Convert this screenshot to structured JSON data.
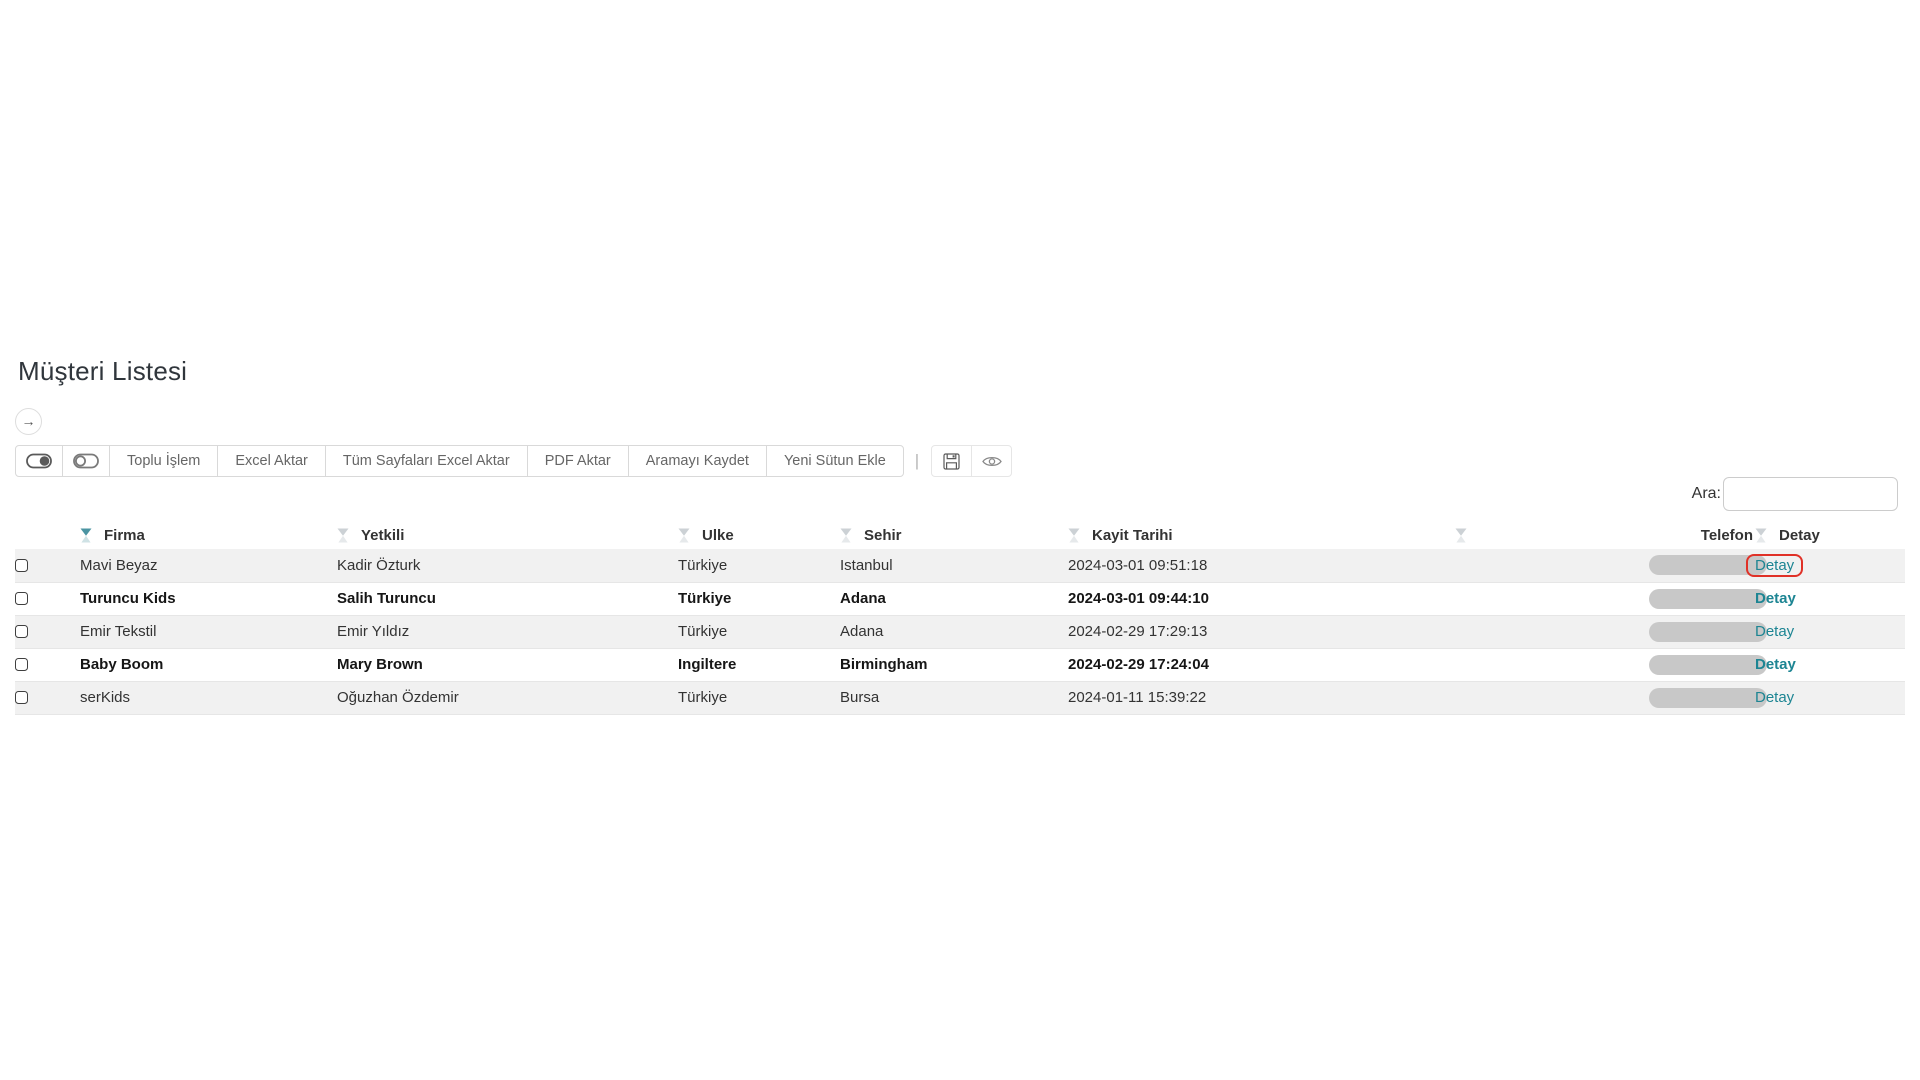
{
  "page": {
    "title": "Müşteri Listesi"
  },
  "panel_toggle": {
    "arrow_icon": "→"
  },
  "toolbar": {
    "buttons": [
      "Toplu İşlem",
      "Excel Aktar",
      "Tüm Sayfaları Excel Aktar",
      "PDF Aktar",
      "Aramayı Kaydet",
      "Yeni Sütun Ekle"
    ],
    "divider": "|",
    "icon_buttons": [
      "save-icon",
      "eye-icon"
    ],
    "toggle_icons": [
      "toggle-on-icon",
      "toggle-off-icon"
    ]
  },
  "search": {
    "label": "Ara:",
    "value": "",
    "placeholder": ""
  },
  "table": {
    "headers": {
      "firma": "Firma",
      "yetkili": "Yetkili",
      "ulke": "Ulke",
      "sehir": "Sehir",
      "kayit": "Kayit Tarihi",
      "telefon": "Telefon",
      "detay": "Detay"
    },
    "rows": [
      {
        "firma": "Mavi Beyaz",
        "yetkili": "Kadir Özturk",
        "ulke": "Türkiye",
        "sehir": "Istanbul",
        "kayit_tarihi": "2024-03-01 09:51:18",
        "telefon_redacted": true,
        "detay": "Detay",
        "bold": false,
        "highlighted": true
      },
      {
        "firma": "Turuncu Kids",
        "yetkili": "Salih Turuncu",
        "ulke": "Türkiye",
        "sehir": "Adana",
        "kayit_tarihi": "2024-03-01 09:44:10",
        "telefon_redacted": true,
        "detay": "Detay",
        "bold": true,
        "highlighted": false
      },
      {
        "firma": "Emir Tekstil",
        "yetkili": "Emir Yıldız",
        "ulke": "Türkiye",
        "sehir": "Adana",
        "kayit_tarihi": "2024-02-29 17:29:13",
        "telefon_redacted": true,
        "detay": "Detay",
        "bold": false,
        "highlighted": false
      },
      {
        "firma": "Baby Boom",
        "yetkili": "Mary Brown",
        "ulke": "Ingiltere",
        "sehir": "Birmingham",
        "kayit_tarihi": "2024-02-29 17:24:04",
        "telefon_redacted": true,
        "detay": "Detay",
        "bold": true,
        "highlighted": false
      },
      {
        "firma": "serKids",
        "yetkili": "Oğuzhan Özdemir",
        "ulke": "Türkiye",
        "sehir": "Bursa",
        "kayit_tarihi": "2024-01-11 15:39:22",
        "telefon_redacted": true,
        "detay": "Detay",
        "bold": false,
        "highlighted": false
      }
    ]
  },
  "colors": {
    "accent_teal": "#1d8593",
    "highlight_red": "#e03127",
    "stripe_gray": "#f1f1f1",
    "pill_gray": "#c8c8c8",
    "filter_active_teal": "#4b94a2",
    "filter_inactive_gray": "#ccd1d5"
  }
}
